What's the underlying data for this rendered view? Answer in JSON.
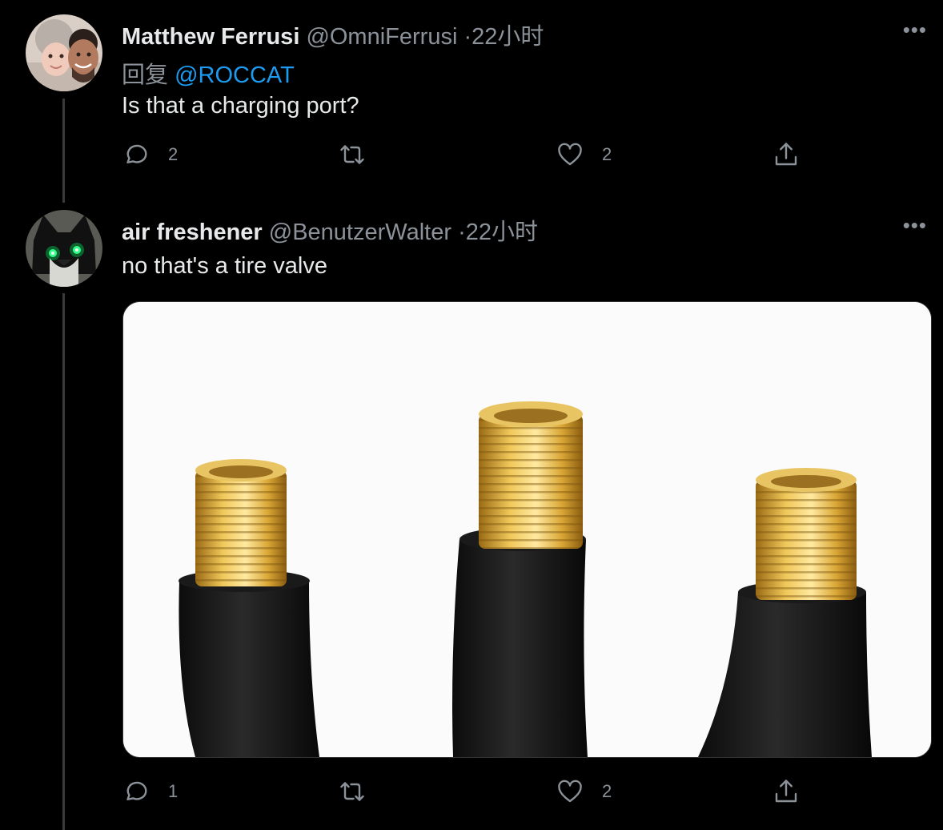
{
  "colors": {
    "background": "#000000",
    "text": "#e7e9ea",
    "muted": "#8b9299",
    "link": "#1d9bf0"
  },
  "tweets": [
    {
      "name": "Matthew Ferrusi",
      "handle": "@OmniFerrusi",
      "separator": "·",
      "time": "22小时",
      "more": "•••",
      "reply_prefix": "回复",
      "reply_mention": "@ROCCAT",
      "text": "Is that a charging port?",
      "avatar_icon": "user-photo-avatar",
      "actions": {
        "reply_count": "2",
        "retweet_count": "",
        "like_count": "2"
      }
    },
    {
      "name": "air freshener",
      "handle": "@BenutzerWalter",
      "separator": "·",
      "time": "22小时",
      "more": "•••",
      "text": "no that's a tire valve",
      "avatar_icon": "cat-avatar",
      "media": "photo-of-three-tire-valves",
      "actions": {
        "reply_count": "1",
        "retweet_count": "",
        "like_count": "2"
      }
    }
  ]
}
